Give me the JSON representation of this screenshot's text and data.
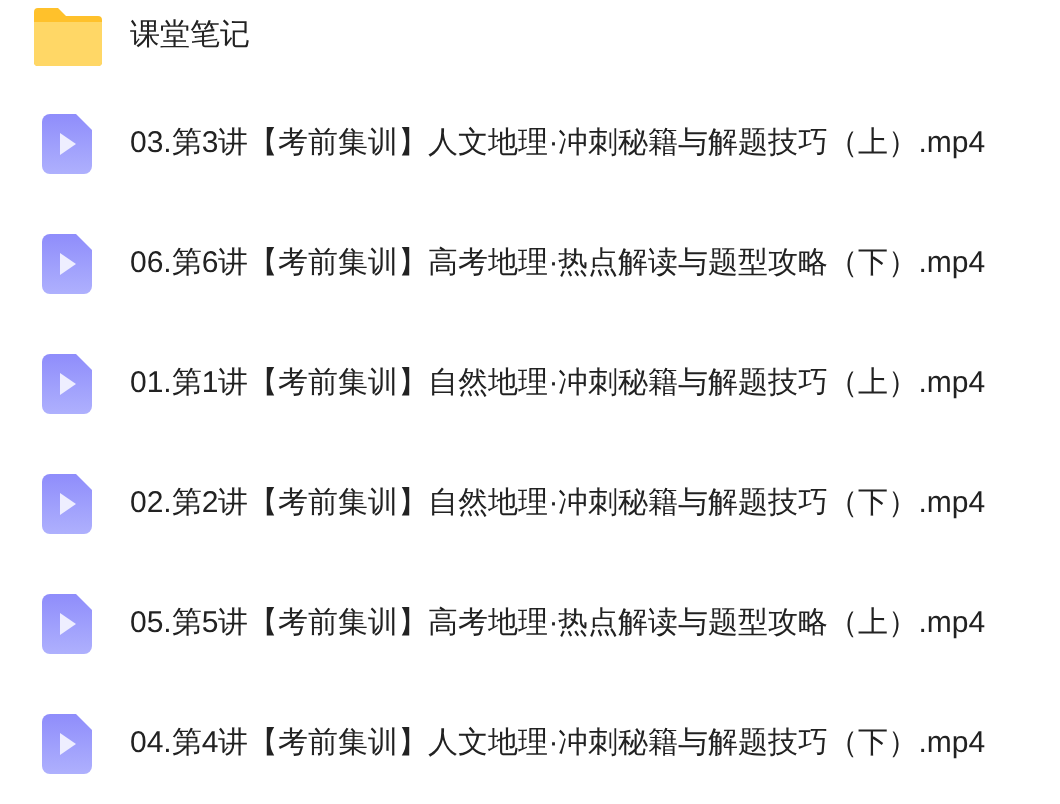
{
  "files": [
    {
      "kind": "folder",
      "name": "课堂笔记"
    },
    {
      "kind": "video",
      "name": "03.第3讲【考前集训】人文地理·冲刺秘籍与解题技巧（上）.mp4"
    },
    {
      "kind": "video",
      "name": "06.第6讲【考前集训】高考地理·热点解读与题型攻略（下）.mp4"
    },
    {
      "kind": "video",
      "name": "01.第1讲【考前集训】自然地理·冲刺秘籍与解题技巧（上）.mp4"
    },
    {
      "kind": "video",
      "name": "02.第2讲【考前集训】自然地理·冲刺秘籍与解题技巧（下）.mp4"
    },
    {
      "kind": "video",
      "name": "05.第5讲【考前集训】高考地理·热点解读与题型攻略（上）.mp4"
    },
    {
      "kind": "video",
      "name": "04.第4讲【考前集训】人文地理·冲刺秘籍与解题技巧（下）.mp4"
    }
  ]
}
